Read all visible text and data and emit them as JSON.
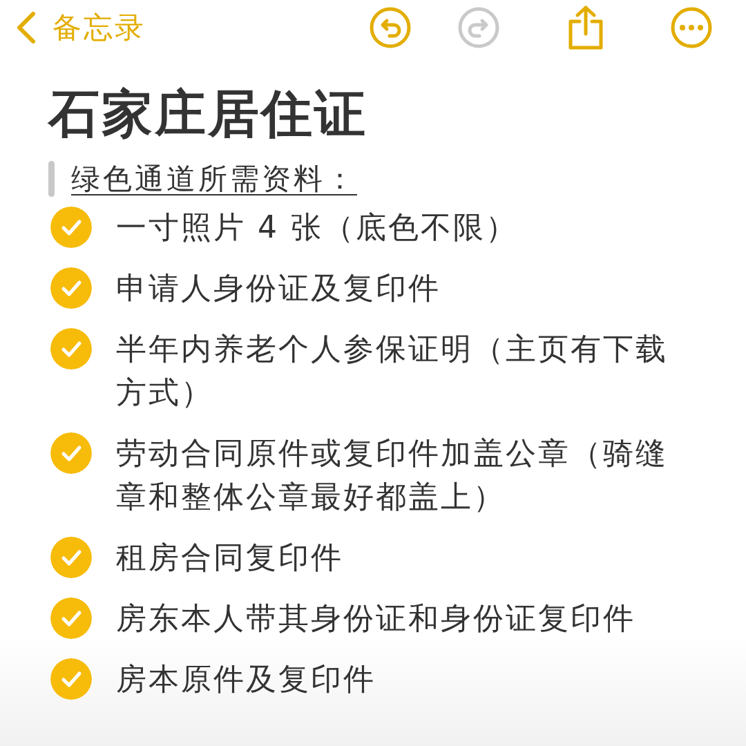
{
  "header": {
    "back_label": "备忘录",
    "undo": {
      "disabled": false
    },
    "redo": {
      "disabled": true
    }
  },
  "title": "石家庄居住证",
  "subheading": "绿色通道所需资料：",
  "checklist": [
    {
      "text": "一寸照片 4 张（底色不限）",
      "checked": true
    },
    {
      "text": "申请人身份证及复印件",
      "checked": true
    },
    {
      "text": "半年内养老个人参保证明（主页有下载方式）",
      "checked": true
    },
    {
      "text": "劳动合同原件或复印件加盖公章（骑缝章和整体公章最好都盖上）",
      "checked": true
    },
    {
      "text": "租房合同复印件",
      "checked": true
    },
    {
      "text": "房东本人带其身份证和身份证复印件",
      "checked": true
    },
    {
      "text": "房本原件及复印件",
      "checked": true
    }
  ]
}
